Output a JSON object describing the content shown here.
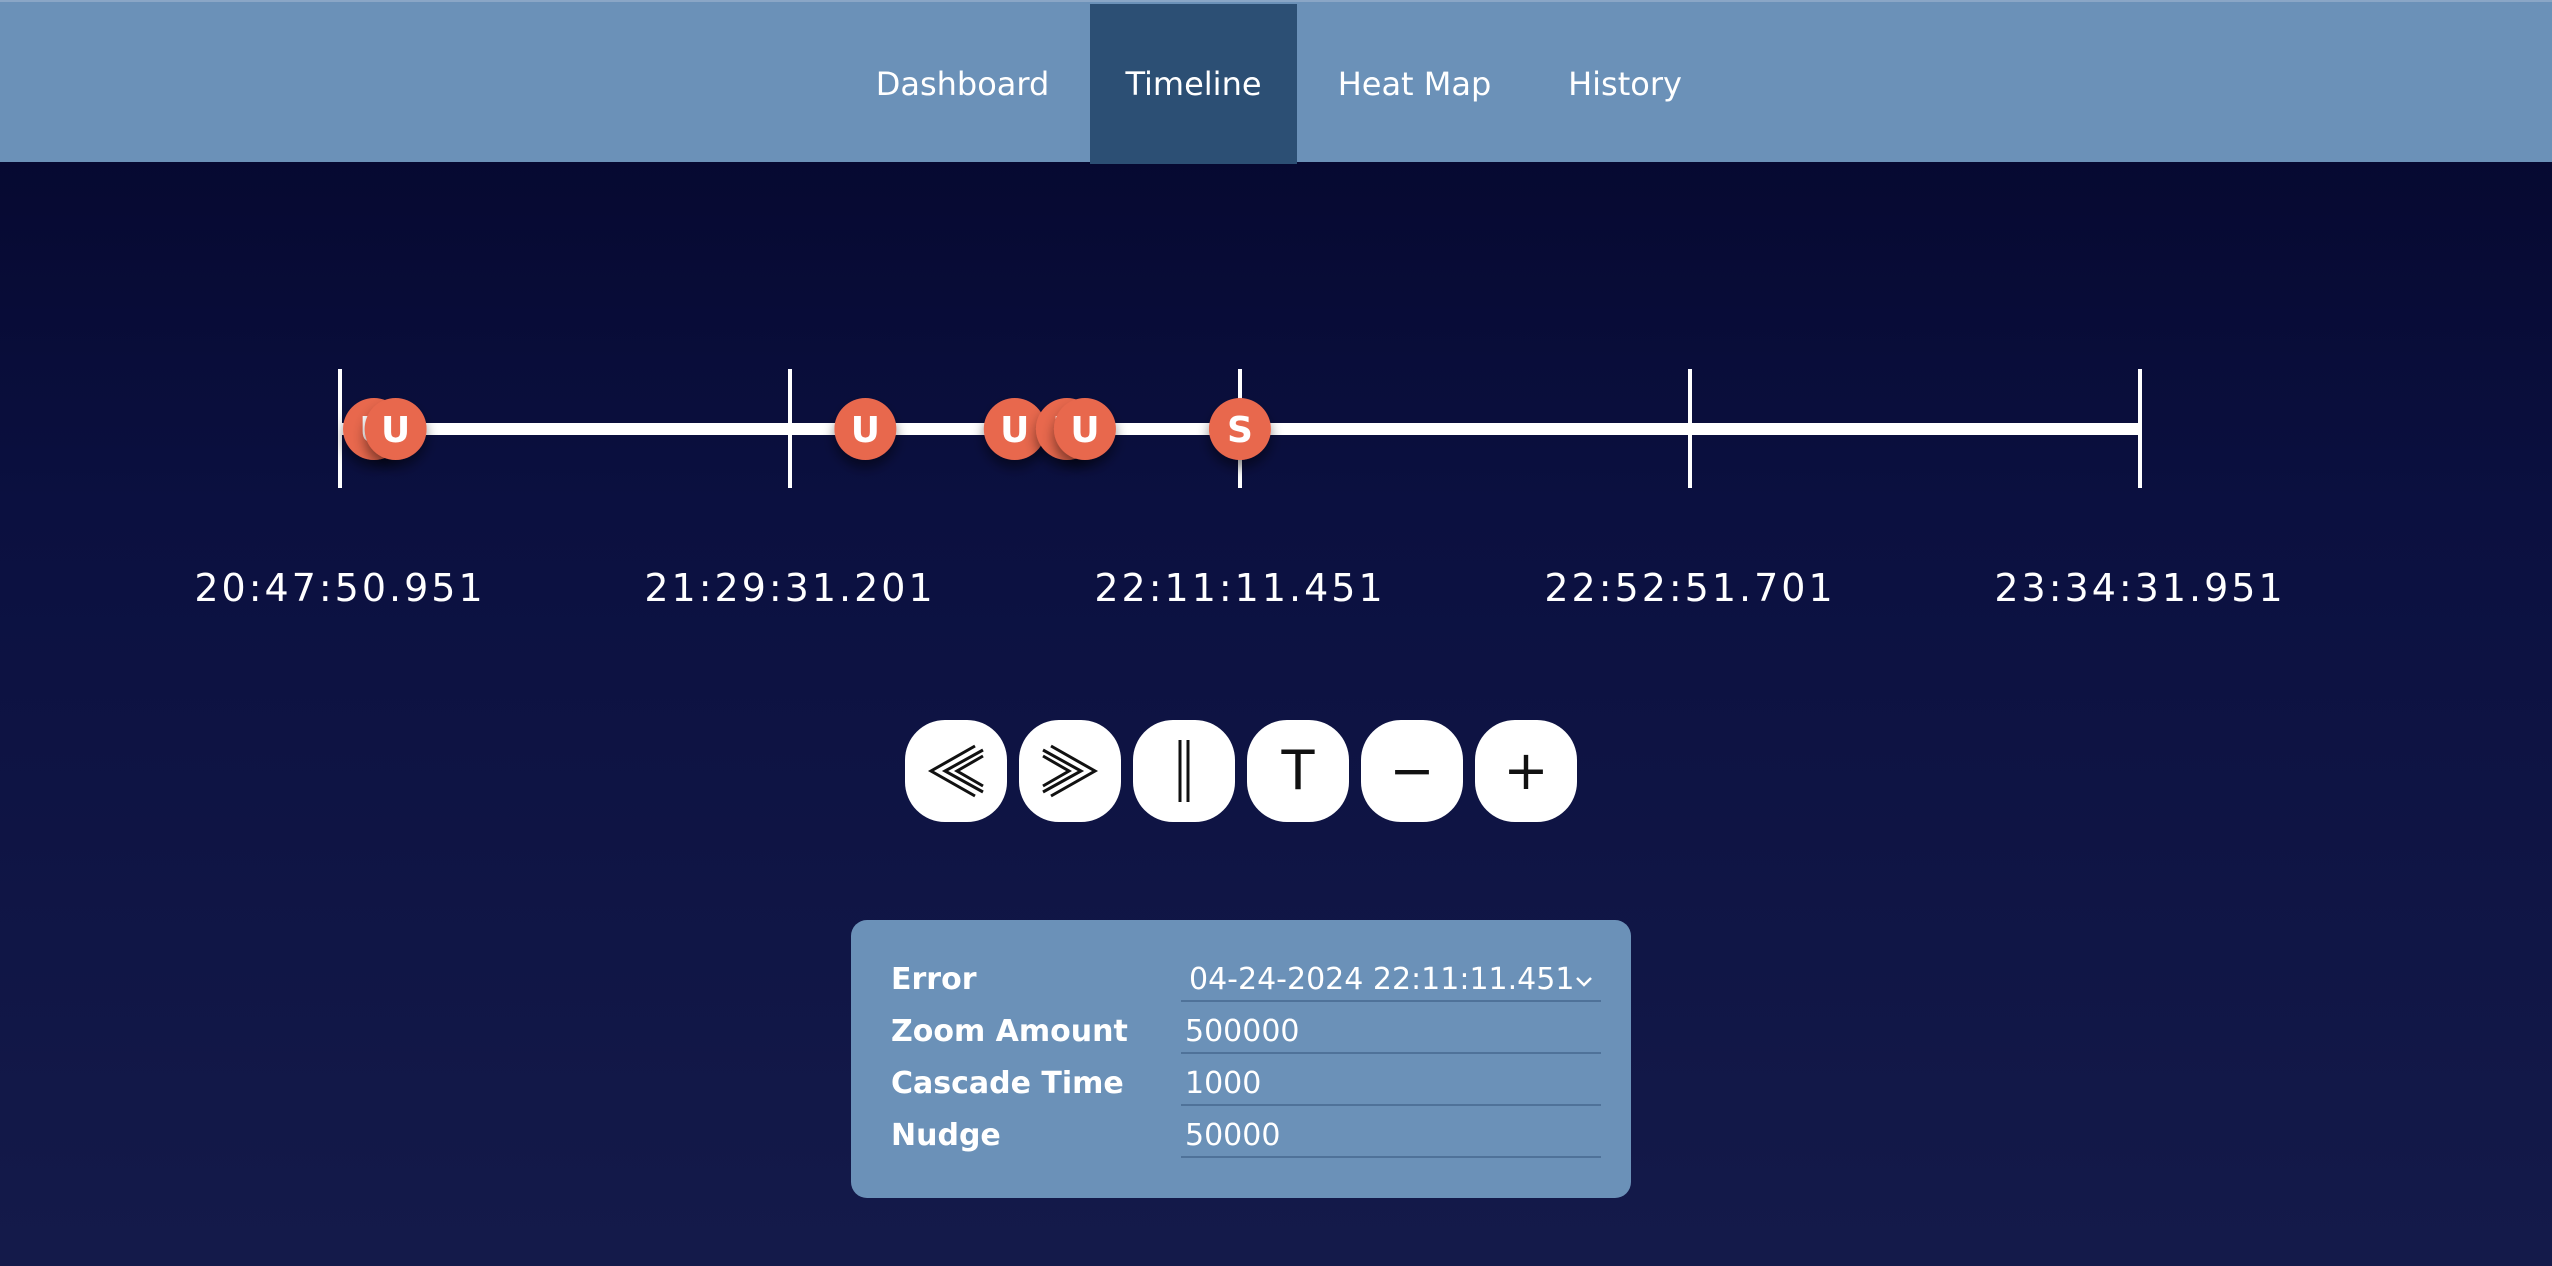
{
  "nav": {
    "tabs": [
      {
        "label": "Dashboard"
      },
      {
        "label": "Timeline"
      },
      {
        "label": "Heat Map"
      },
      {
        "label": "History"
      }
    ],
    "active_tab": "Timeline"
  },
  "timeline": {
    "tick_labels": [
      "20:47:50.951",
      "21:29:31.201",
      "22:11:11.451",
      "22:52:51.701",
      "23:34:31.951"
    ],
    "markers": [
      {
        "letter": "U",
        "time": "20:51:00"
      },
      {
        "letter": "U",
        "time": "20:53:00"
      },
      {
        "letter": "U",
        "time": "21:36:30"
      },
      {
        "letter": "U",
        "time": "21:50:20"
      },
      {
        "letter": "U",
        "time": "21:55:10"
      },
      {
        "letter": "U",
        "time": "21:56:50"
      },
      {
        "letter": "S",
        "time": "22:11:11"
      }
    ],
    "marker_color": "#e8674e",
    "line_color": "#ffffff"
  },
  "controls": {
    "buttons": [
      {
        "name": "rewind",
        "icon": "double-chevron-left-icon"
      },
      {
        "name": "fast-forward",
        "icon": "double-chevron-right-icon"
      },
      {
        "name": "pause",
        "icon": "pause-bars-icon"
      },
      {
        "name": "text",
        "label": "T"
      },
      {
        "name": "zoom-out",
        "label": "−"
      },
      {
        "name": "zoom-in",
        "label": "+"
      }
    ]
  },
  "settings": {
    "error": {
      "label": "Error",
      "value": "04-24-2024 22:11:11.451"
    },
    "zoom_amount": {
      "label": "Zoom Amount",
      "value": "500000"
    },
    "cascade_time": {
      "label": "Cascade Time",
      "value": "1000"
    },
    "nudge": {
      "label": "Nudge",
      "value": "50000"
    }
  },
  "colors": {
    "nav_bg": "#6b91b8",
    "nav_active": "#2c4f74",
    "panel_bg": "#6b91b8",
    "page_bg_top": "#04062a",
    "page_bg_bottom": "#141a4a"
  }
}
